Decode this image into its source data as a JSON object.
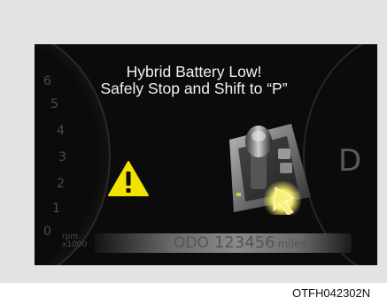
{
  "message": {
    "line1": "Hybrid Battery Low!",
    "line2": "Safely Stop and Shift to “P”"
  },
  "tachometer": {
    "ticks": [
      "6",
      "5",
      "4",
      "3",
      "2",
      "1",
      "0"
    ],
    "unit_line1": "rpm",
    "unit_line2": "x1000"
  },
  "gear_indicator": "D",
  "odometer": {
    "label": "ODO",
    "value": "123456",
    "unit": "miles"
  },
  "caption": "OTFH042302N",
  "warning_icon": "warning-triangle-icon",
  "colors": {
    "warning": "#f2e200",
    "background": "#0b0b0b",
    "text": "#f2f2f2"
  }
}
